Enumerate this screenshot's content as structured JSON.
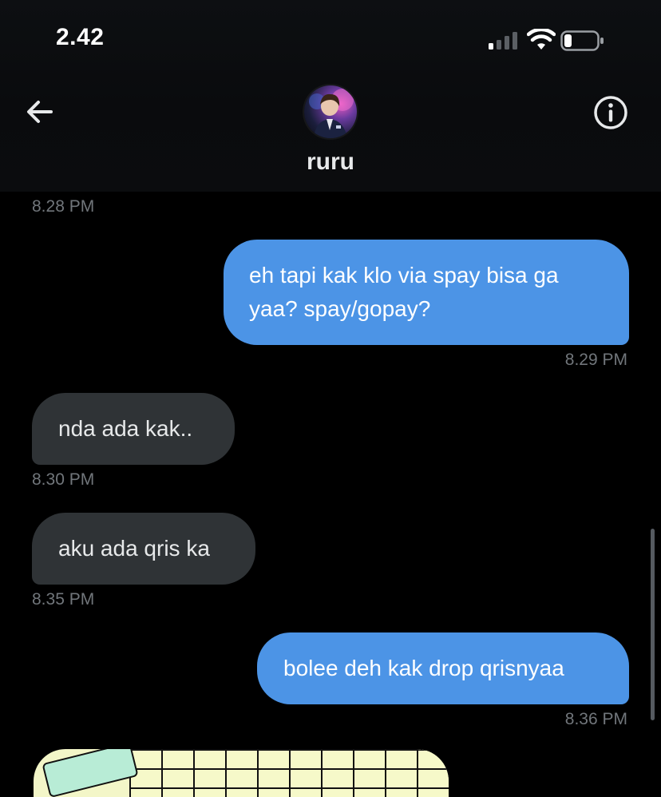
{
  "status_bar": {
    "time": "2.42",
    "signal_icon": "cellular-signal-icon",
    "wifi_icon": "wifi-icon",
    "battery_icon": "battery-low-icon",
    "battery_level": 0.2
  },
  "header": {
    "back_icon": "arrow-left-icon",
    "info_icon": "info-circle-icon",
    "contact_name": "ruru"
  },
  "colors": {
    "background": "#000000",
    "sent_bubble": "#4c94e6",
    "received_bubble": "#2f3336",
    "timestamp": "#71767b",
    "text": "#e7e9ea"
  },
  "messages": [
    {
      "type": "timestamp",
      "side": "left",
      "time": "8.28 PM"
    },
    {
      "type": "sent",
      "lines": [
        "eh tapi kak klo via spay bisa ga",
        "yaa? spay/gopay?"
      ],
      "time": "8.29 PM"
    },
    {
      "type": "received",
      "text": "nda ada kak..",
      "time": "8.30 PM"
    },
    {
      "type": "received",
      "text": "aku ada qris ka",
      "time": "8.35 PM"
    },
    {
      "type": "sent",
      "text": "bolee deh kak drop qrisnyaa",
      "time": "8.36 PM"
    },
    {
      "type": "image",
      "description_icon": "image-attachment"
    }
  ]
}
